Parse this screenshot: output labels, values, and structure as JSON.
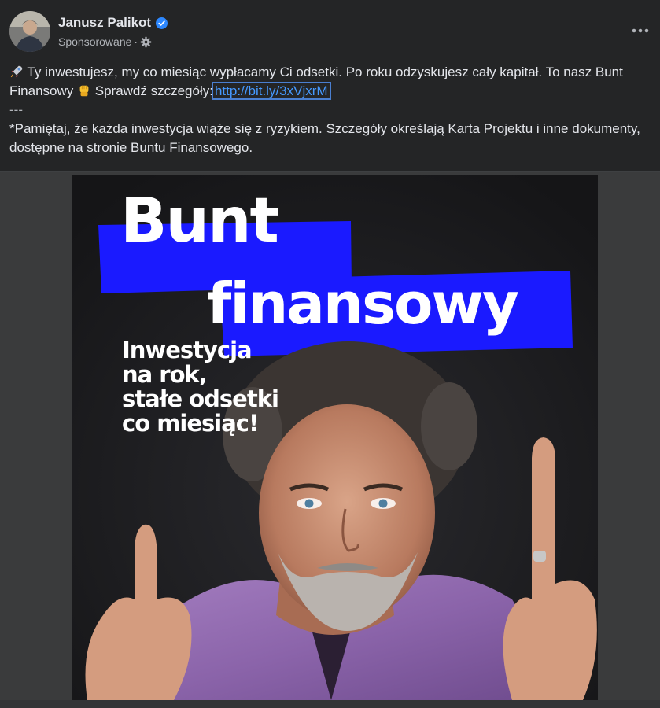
{
  "header": {
    "author_name": "Janusz Palikot",
    "sponsored_label": "Sponsorowane",
    "separator": "·",
    "verified_icon": "verified-badge-icon",
    "audience_icon": "gear-icon",
    "more_icon": "more-dots-icon",
    "more_label": "•••"
  },
  "post": {
    "line1_pre": "Ty inwestujesz, my co miesiąc wypłacamy Ci odsetki. Po roku odzyskujesz cały kapitał. To nasz Bunt Finansowy",
    "line1_mid": "Sprawdź szczegóły:",
    "link_text": "http://bit.ly/3xVjxrM",
    "divider": "---",
    "disclaimer": "*Pamiętaj, że każda inwestycja wiąże się z ryzykiem. Szczegóły określają Karta Projektu i inne dokumenty, dostępne na stronie Buntu Finansowego.",
    "rocket_icon": "rocket-emoji-icon",
    "fist_icon": "raised-fist-emoji-icon"
  },
  "ad_image": {
    "title_line1": "Bunt",
    "title_line2": "finansowy",
    "tagline": [
      "Inwestycja",
      "na rok,",
      "stałe odsetki",
      "co miesiąc!"
    ],
    "accent_color": "#1a1aff",
    "background_color": "#1a1a1c"
  },
  "colors": {
    "surface": "#242526",
    "text_primary": "#e4e6eb",
    "text_secondary": "#b0b3b8",
    "link": "#4599ff",
    "verified": "#2d88ff"
  }
}
